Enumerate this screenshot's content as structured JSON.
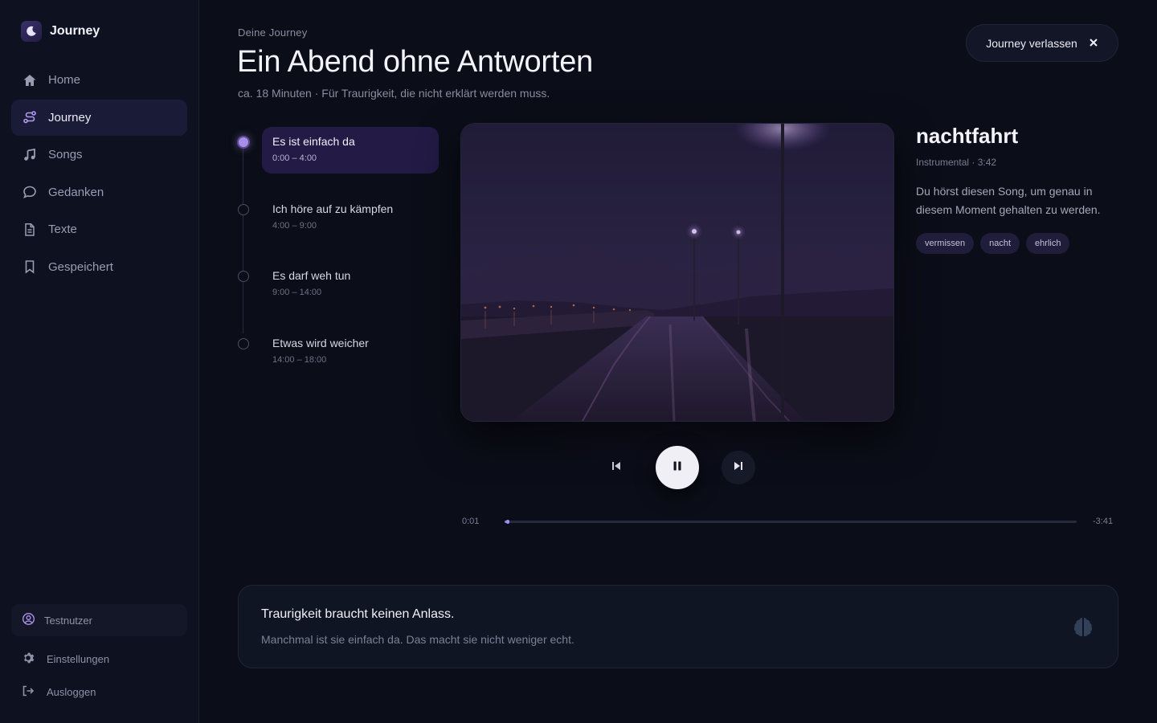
{
  "brand": {
    "name": "Journey"
  },
  "sidebar": {
    "items": [
      {
        "label": "Home",
        "icon": "home-icon",
        "active": false
      },
      {
        "label": "Journey",
        "icon": "journey-icon",
        "active": true
      },
      {
        "label": "Songs",
        "icon": "music-note-icon",
        "active": false
      },
      {
        "label": "Gedanken",
        "icon": "chat-bubble-icon",
        "active": false
      },
      {
        "label": "Texte",
        "icon": "document-icon",
        "active": false
      },
      {
        "label": "Gespeichert",
        "icon": "bookmark-icon",
        "active": false
      }
    ],
    "user": {
      "name": "Testnutzer",
      "icon": "user-circle-icon"
    },
    "settings_label": "Einstellungen",
    "logout_label": "Ausloggen"
  },
  "header": {
    "eyebrow": "Deine Journey",
    "title": "Ein Abend ohne Antworten",
    "subtitle": "ca. 18 Minuten · Für Traurigkeit, die nicht erklärt werden muss.",
    "exit_label": "Journey verlassen"
  },
  "timeline": [
    {
      "title": "Es ist einfach da",
      "time": "0:00 – 4:00",
      "active": true
    },
    {
      "title": "Ich höre auf zu kämpfen",
      "time": "4:00 – 9:00",
      "active": false
    },
    {
      "title": "Es darf weh tun",
      "time": "9:00 – 14:00",
      "active": false
    },
    {
      "title": "Etwas wird weicher",
      "time": "14:00 – 18:00",
      "active": false
    }
  ],
  "player": {
    "current_time": "0:01",
    "remaining_time": "-3:41",
    "progress": 0.005,
    "state": "playing"
  },
  "song": {
    "title": "nachtfahrt",
    "meta": "Instrumental · 3:42",
    "description": "Du hörst diesen Song, um genau in diesem Moment gehalten zu werden.",
    "tags": [
      "vermissen",
      "nacht",
      "ehrlich"
    ]
  },
  "thought": {
    "title": "Traurigkeit braucht keinen Anlass.",
    "text": "Manchmal ist sie einfach da. Das macht sie nicht weniger echt.",
    "icon": "brain-icon"
  },
  "colors": {
    "accent": "#a98ee6",
    "background": "#0b0d18",
    "sidebar": "#0d1120"
  }
}
